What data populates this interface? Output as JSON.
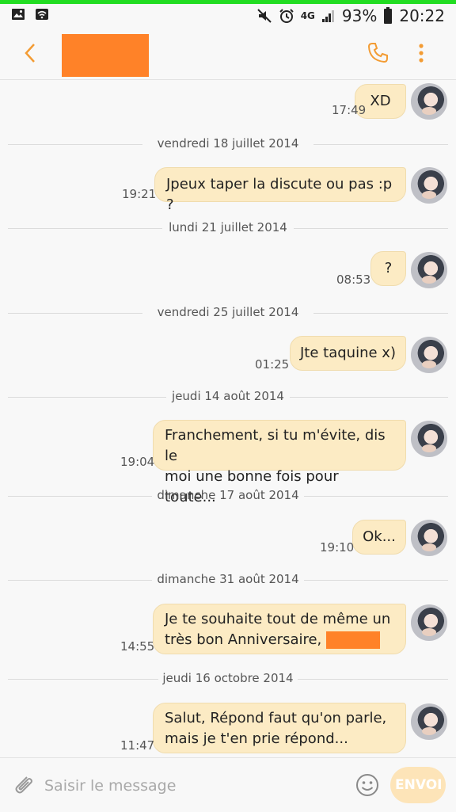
{
  "status_bar": {
    "network": "4G",
    "battery": "93%",
    "time": "20:22"
  },
  "header": {
    "contact_name": "",
    "call_icon": "phone-icon",
    "menu_icon": "more-vertical-icon"
  },
  "messages": [
    {
      "type": "message",
      "text": "XD",
      "time": "17:49"
    },
    {
      "type": "date",
      "text": "vendredi 18 juillet 2014"
    },
    {
      "type": "message",
      "text": "Jpeux taper la discute ou pas :p ?",
      "time": "19:21"
    },
    {
      "type": "date",
      "text": "lundi 21 juillet 2014"
    },
    {
      "type": "message",
      "text": "?",
      "time": "08:53"
    },
    {
      "type": "date",
      "text": "vendredi 25 juillet 2014"
    },
    {
      "type": "message",
      "text": "Jte taquine x)",
      "time": "01:25"
    },
    {
      "type": "date",
      "text": "jeudi 14 août 2014"
    },
    {
      "type": "message",
      "text": "Franchement, si tu m'évite, dis le\nmoi une bonne fois pour toute...",
      "time": "19:04"
    },
    {
      "type": "date",
      "text": "dimanche 17 août 2014"
    },
    {
      "type": "message",
      "text": "Ok...",
      "time": "19:10"
    },
    {
      "type": "date",
      "text": "dimanche 31 août 2014"
    },
    {
      "type": "message",
      "text": "Je te souhaite tout de même un\ntrès bon Anniversaire,",
      "time": "14:55",
      "redacted_suffix": true
    },
    {
      "type": "date",
      "text": "jeudi 16 octobre 2014"
    },
    {
      "type": "message",
      "text": "Salut,  Répond faut qu'on parle,\nmais je t'en prie répond...",
      "time": "11:47"
    }
  ],
  "composer": {
    "placeholder": "Saisir le message",
    "send_label": "ENVOI"
  },
  "colors": {
    "accent": "#f39c34",
    "bubble": "#fcebc4",
    "redaction": "#ff8228",
    "status_indicator": "#22dd22"
  }
}
